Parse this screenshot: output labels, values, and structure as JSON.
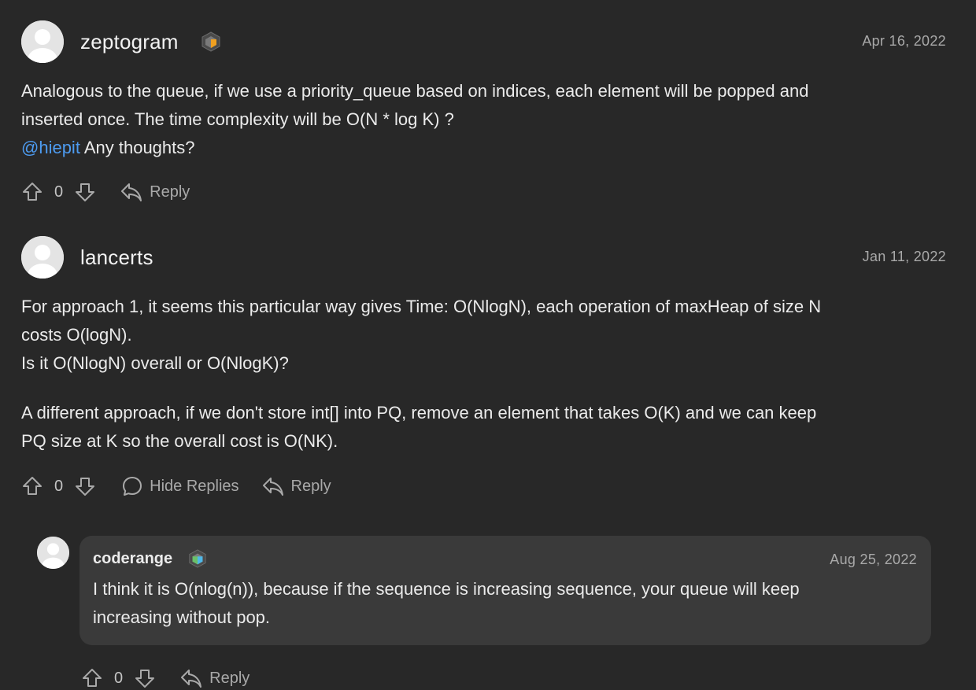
{
  "comments": [
    {
      "username": "zeptogram",
      "date": "Apr 16, 2022",
      "body_line1": "Analogous to the queue, if we use a priority_queue based on indices, each element will be popped and",
      "body_line2": "inserted once. The time complexity will be O(N * log K) ?",
      "mention": "@hiepit",
      "body_line3_rest": " Any thoughts?",
      "votes": "0",
      "reply_label": "Reply",
      "badge_colors": [
        "#5a5a5a",
        "#f0a020"
      ]
    },
    {
      "username": "lancerts",
      "date": "Jan 11, 2022",
      "body_line1": "For approach 1, it seems this particular way gives Time: O(NlogN), each operation of maxHeap of size N",
      "body_line2": "costs O(logN).",
      "body_line3": "Is it O(NlogN) overall or O(NlogK)?",
      "body_line4": "A different approach, if we don't store int[] into PQ, remove an element that takes O(K) and we can keep",
      "body_line5": "PQ size at K so the overall cost is O(NK).",
      "votes": "0",
      "hide_replies_label": "Hide Replies",
      "reply_label": "Reply"
    }
  ],
  "reply": {
    "username": "coderange",
    "date": "Aug 25, 2022",
    "body_line1": "I think it is O(nlog(n)), because if the sequence is increasing sequence, your queue will keep",
    "body_line2": "increasing without pop.",
    "votes": "0",
    "reply_label": "Reply",
    "badge_colors": [
      "#5a5a5a",
      "#4fb8e8"
    ]
  },
  "icons": {
    "upvote": "arrow-up-outline-icon",
    "downvote": "arrow-down-outline-icon",
    "reply": "reply-arrow-icon",
    "comment": "speech-bubble-icon",
    "avatar": "default-user-icon"
  }
}
